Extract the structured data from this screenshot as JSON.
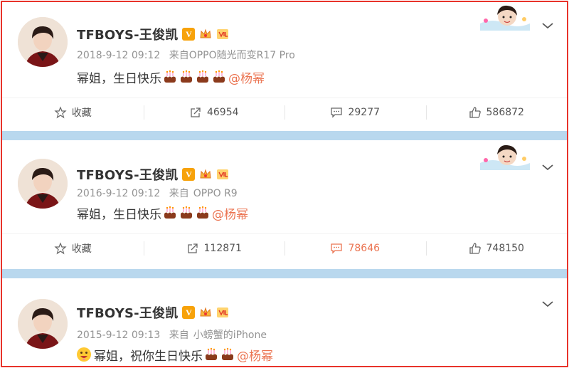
{
  "colors": {
    "frame": "#e8332a",
    "separator": "#b9d8ee",
    "mention": "#eb7350",
    "meta": "#939393"
  },
  "posts": [
    {
      "author": "TFBOYS-王俊凯",
      "time": "2018-9-12 09:12",
      "source_prefix": "来自",
      "source": "OPPO随光而变R17 Pro",
      "text": "幂姐，生日快乐",
      "cake_count": 4,
      "mention": "@杨幂",
      "has_decoration": true,
      "actions": {
        "favorite": "收藏",
        "repost": "46954",
        "comment": "29277",
        "like": "586872"
      }
    },
    {
      "author": "TFBOYS-王俊凯",
      "time": "2016-9-12 09:12",
      "source_prefix": "来自",
      "source": "OPPO R9",
      "text": "幂姐，生日快乐",
      "cake_count": 3,
      "mention": "@杨幂",
      "has_decoration": true,
      "actions": {
        "favorite": "收藏",
        "repost": "112871",
        "comment": "78646",
        "like": "748150"
      }
    },
    {
      "author": "TFBOYS-王俊凯",
      "time": "2015-9-12 09:13",
      "source_prefix": "来自",
      "source": "小螃蟹的iPhone",
      "text": "幂姐，祝你生日快乐",
      "cake_count": 2,
      "mention": "@杨幂",
      "has_decoration": false
    }
  ],
  "icons": {
    "badge_v": "V",
    "favorite": "star-icon",
    "repost": "share-icon",
    "comment": "comment-icon",
    "like": "thumbs-up-icon",
    "menu": "chevron-down-icon",
    "cake": "birthday-cake-icon",
    "face": "grinning-face-icon"
  }
}
